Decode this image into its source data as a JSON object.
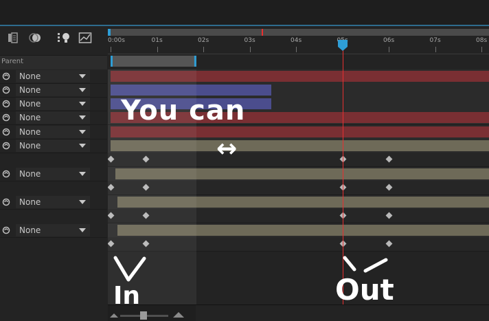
{
  "parent_column": {
    "header": "Parent",
    "rows": [
      {
        "value": "None"
      },
      {
        "value": "None"
      },
      {
        "value": "None"
      },
      {
        "value": "None"
      },
      {
        "value": "None"
      },
      {
        "value": "None"
      },
      {
        "value": "None"
      },
      {
        "value": "None"
      },
      {
        "value": "None"
      }
    ]
  },
  "ruler": {
    "ticks": [
      "0:00s",
      "01s",
      "02s",
      "03s",
      "04s",
      "05s",
      "06s",
      "07s",
      "08s"
    ]
  },
  "layers": [
    {
      "kind": "bar",
      "color": "#7a2f33",
      "start_s": 0.0,
      "end_s": 8.2
    },
    {
      "kind": "bar",
      "color": "#4b4d8d",
      "start_s": 0.0,
      "end_s": 3.47
    },
    {
      "kind": "bar",
      "color": "#4b4d8d",
      "start_s": 0.0,
      "end_s": 3.47
    },
    {
      "kind": "bar",
      "color": "#7a2f33",
      "start_s": 0.0,
      "end_s": 8.2
    },
    {
      "kind": "bar",
      "color": "#7a2f33",
      "start_s": 0.0,
      "end_s": 8.2
    },
    {
      "kind": "bar",
      "color": "#6e6a58",
      "start_s": 0.0,
      "end_s": 8.2
    },
    {
      "kind": "keys",
      "times_s": [
        0.0,
        0.75,
        5.0,
        6.0
      ]
    },
    {
      "kind": "bar",
      "color": "#6e6a58",
      "start_s": 0.1,
      "end_s": 8.2
    },
    {
      "kind": "keys",
      "times_s": [
        0.0,
        0.75,
        5.0,
        6.0
      ]
    },
    {
      "kind": "bar",
      "color": "#6e6a58",
      "start_s": 0.15,
      "end_s": 8.2
    },
    {
      "kind": "keys",
      "times_s": [
        0.0,
        0.75,
        5.0,
        6.0
      ]
    },
    {
      "kind": "bar",
      "color": "#6e6a58",
      "start_s": 0.15,
      "end_s": 8.2
    },
    {
      "kind": "keys",
      "times_s": [
        0.0,
        0.75,
        5.0,
        6.0
      ]
    }
  ],
  "playhead_s": 5.0,
  "work_area": {
    "start_s": 0.0,
    "end_s": 1.85
  },
  "annotations": {
    "you_can": "You can",
    "arrow": "↔",
    "in_label": "In",
    "out_label": "Out"
  },
  "colors": {
    "accent": "#2e9ed6",
    "playhead": "#e83030"
  }
}
